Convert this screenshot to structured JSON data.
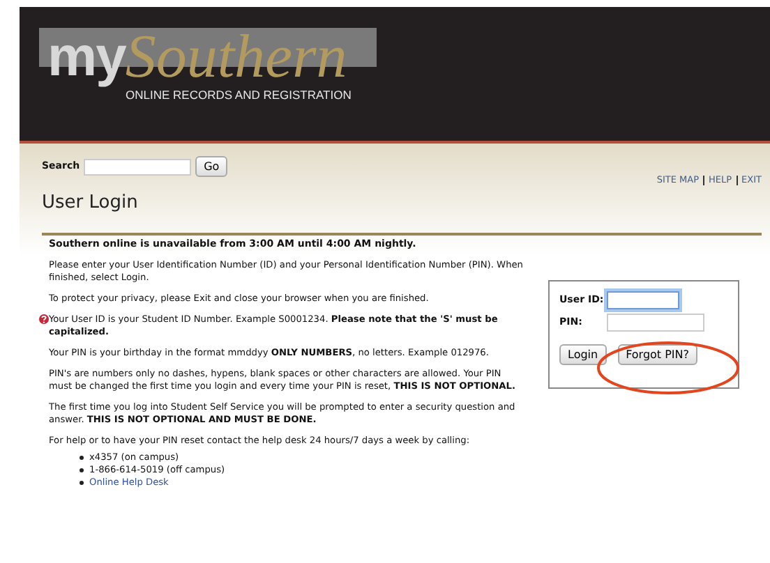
{
  "header": {
    "logo_prefix": "my",
    "logo_name": "Southern",
    "tagline": "ONLINE RECORDS AND REGISTRATION"
  },
  "search": {
    "label": "Search",
    "button": "Go"
  },
  "links": [
    "SITE MAP",
    "HELP",
    "EXIT"
  ],
  "title": "User Login",
  "notice": "Southern online is unavailable from 3:00 AM until 4:00 AM nightly.",
  "paragraphs": [
    "Please enter your User Identification Number (ID) and your Personal Identification Number (PIN). When finished, select Login.",
    "To protect your privacy, please Exit and close your browser when you are finished."
  ],
  "help_paragraphs": [
    "Your User ID is your Student ID Number. Example S0001234. **Please note that the 'S' must be capitalized.**",
    "Your PIN is your birthday in the format mmddyy **ONLY NUMBERS**, no letters. Example 012976.",
    "PIN's are numbers only no dashes, hypens, blank spaces or other characters are allowed. Your PIN must be changed the first time you login and every time your PIN is reset, **THIS IS NOT OPTIONAL.**",
    "The first time you log into Student Self Service you will be prompted to enter a security question and answer. **THIS IS NOT OPTIONAL AND MUST BE DONE.**",
    "For help or to have your PIN reset contact the help desk 24 hours/7 days a week by calling:"
  ],
  "contacts": [
    {
      "kind": "text",
      "text": "x4357 (on campus)"
    },
    {
      "kind": "text",
      "text": "1-866-614-5019 (off campus)"
    },
    {
      "kind": "link",
      "text": "Online Help Desk"
    }
  ],
  "login": {
    "user_id_label": "User ID:",
    "pin_label": "PIN:",
    "user_id_focused": true,
    "login_button": "Login",
    "forgot_button": "Forgot PIN?",
    "forgot_circled": true
  }
}
